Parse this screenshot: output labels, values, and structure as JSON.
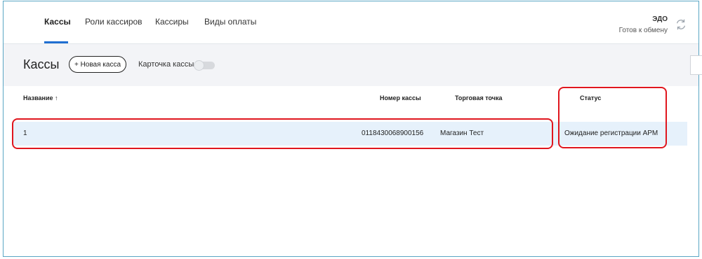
{
  "tabs": [
    {
      "label": "Кассы",
      "active": true
    },
    {
      "label": "Роли кассиров",
      "active": false
    },
    {
      "label": "Кассиры",
      "active": false
    },
    {
      "label": "Виды оплаты",
      "active": false
    }
  ],
  "edo": {
    "title": "ЭДО",
    "status": "Готов к обмену",
    "icon": "sync-icon"
  },
  "page": {
    "title": "Кассы",
    "new_button": "+ Новая касса",
    "card_toggle_label": "Карточка кассы",
    "card_toggle_on": false
  },
  "table": {
    "columns": [
      "Название ↑",
      "Номер кассы",
      "Торговая точка",
      "Статус"
    ],
    "rows": [
      {
        "name": "1",
        "number": "0118430068900156",
        "store": "Магазин Тест",
        "status": "Ожидание регистрации АРМ"
      }
    ]
  },
  "colors": {
    "accent": "#1f6fd1",
    "highlight": "#e0161e",
    "row_selected": "#e6f1fb"
  }
}
